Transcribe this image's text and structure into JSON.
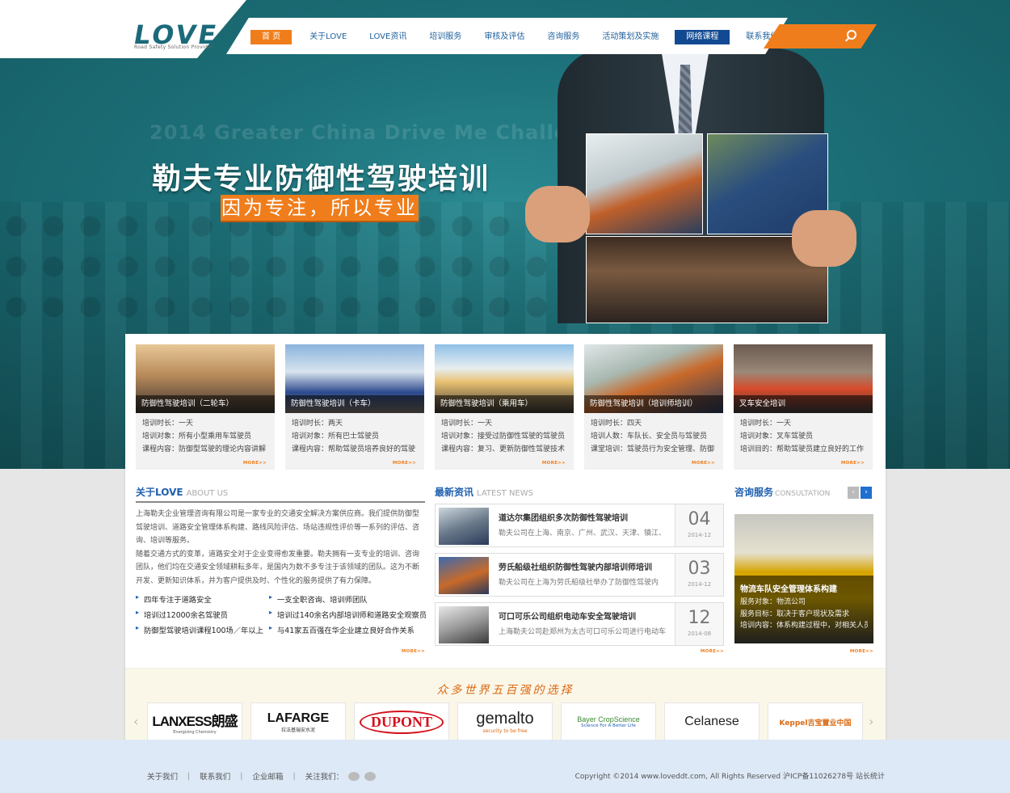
{
  "nav": {
    "logo": "LOVE",
    "logo_sub": "Road Safety Solution Provider",
    "items": [
      {
        "label": "首 页",
        "style": "active"
      },
      {
        "label": "关于LOVE",
        "style": ""
      },
      {
        "label": "LOVE资讯",
        "style": ""
      },
      {
        "label": "培训服务",
        "style": ""
      },
      {
        "label": "审核及评估",
        "style": ""
      },
      {
        "label": "咨询服务",
        "style": ""
      },
      {
        "label": "活动策划及实施",
        "style": ""
      },
      {
        "label": "网络课程",
        "style": "dark"
      },
      {
        "label": "联系我们",
        "style": ""
      }
    ]
  },
  "hero": {
    "ghost_title": "2014 Greater China Drive Me Challenge",
    "title": "勒夫专业防御性驾驶培训",
    "subtitle": "因为专注，所以专业"
  },
  "cards": [
    {
      "caption": "防御性驾驶培训（二轮车）",
      "lines": [
        "培训时长：一天",
        "培训对象：所有小型乘用车驾驶员",
        "课程内容：防御型驾驶的理论内容讲解"
      ]
    },
    {
      "caption": "防御性驾驶培训（卡车）",
      "lines": [
        "培训时长：两天",
        "培训对象：所有巴士驾驶员",
        "课程内容：帮助驾驶员培养良好的驾驶"
      ]
    },
    {
      "caption": "防御性驾驶培训（乘用车）",
      "lines": [
        "培训时长：一天",
        "培训对象：接受过防御性驾驶的驾驶员",
        "课程内容：复习、更新防御性驾驶技术"
      ]
    },
    {
      "caption": "防御性驾驶培训（培训师培训）",
      "lines": [
        "培训时长：四天",
        "培训人数：车队长、安全员与驾驶员",
        "课堂培训：驾驶员行为安全管理、防御"
      ]
    },
    {
      "caption": "叉车安全培训",
      "lines": [
        "培训时长：一天",
        "培训对象：叉车驾驶员",
        "培训目的：帮助驾驶员建立良好的工作"
      ]
    }
  ],
  "more_label": "MORE>>",
  "about": {
    "title_cn": "关于LOVE",
    "title_en": "ABOUT US",
    "paragraphs": [
      "上海勒夫企业管理咨询有限公司是一家专业的交通安全解决方案供应商。我们提供防御型驾驶培训、道路安全管理体系构建、路线风险评估、场站违规性评价等一系列的评估、咨询、培训等服务。",
      "随着交通方式的变革，道路安全对于企业变得愈发重要。勒夫拥有一支专业的培训、咨询团队，他们均在交通安全领域耕耘多年，是国内为数不多专注于该领域的团队。这为不断开发、更新知识体系，并为客户提供及时、个性化的服务提供了有力保障。"
    ],
    "bullets": [
      "四年专注于道路安全",
      "一支全职咨询、培训师团队",
      "培训过12000余名驾驶员",
      "培训过140余名内部培训师和道路安全观察员",
      "防御型驾驶培训课程100场／年以上",
      "与41家五百强在华企业建立良好合作关系"
    ]
  },
  "news": {
    "title_cn": "最新资讯",
    "title_en": "LATEST NEWS",
    "items": [
      {
        "title": "道达尔集团组织多次防御性驾驶培训",
        "desc": "勒夫公司在上海、南京、广州、武汉、天津、镇江、",
        "day": "04",
        "ym": "2014-12"
      },
      {
        "title": "劳氏船级社组织防御性驾驶内部培训师培训",
        "desc": "勒夫公司在上海为劳氏船级社举办了防御性驾驶内",
        "day": "03",
        "ym": "2014-12"
      },
      {
        "title": "可口可乐公司组织电动车安全驾驶培训",
        "desc": "上海勒夫公司赴郑州为太古可口可乐公司进行电动车",
        "day": "12",
        "ym": "2014-08"
      }
    ]
  },
  "consult": {
    "title_cn": "咨询服务",
    "title_en": "CONSULTATION",
    "prev": "‹",
    "next": "›",
    "heading": "物流车队安全管理体系构建",
    "lines": [
      "服务对象：物流公司",
      "服务目标：取决于客户现状及需求",
      "培训内容：体系构建过程中，对相关人员"
    ]
  },
  "partners": {
    "title": "众多世界五百强的选择",
    "prev": "‹",
    "next": "›",
    "logos": [
      {
        "name": "LANXESS朗盛",
        "sub": "Energizing Chemistry",
        "color": "#111111"
      },
      {
        "name": "LAFARGE",
        "sub": "拉法基瑞安水泥",
        "color": "#111111"
      },
      {
        "name": "DUPONT",
        "sub": "",
        "color": "#d4101c"
      },
      {
        "name": "gemalto",
        "sub": "security to be free",
        "color": "#222222"
      },
      {
        "name": "Bayer CropScience",
        "sub": "Science For A Better Life",
        "color": "#3a8a30"
      },
      {
        "name": "Celanese",
        "sub": "",
        "color": "#222222"
      },
      {
        "name": "Keppel吉宝置业中国",
        "sub": "",
        "color": "#d96a14"
      }
    ]
  },
  "footer": {
    "links": [
      "关于我们",
      "联系我们",
      "企业邮箱",
      "关注我们："
    ],
    "copyright": "Copyright ©2014 www.loveddt.com, All Rights Reserved 沪ICP备11026278号 站长统计"
  },
  "colors": {
    "accent": "#f07d1c",
    "brand": "#1f5fb0",
    "teal": "#1c6f78"
  }
}
